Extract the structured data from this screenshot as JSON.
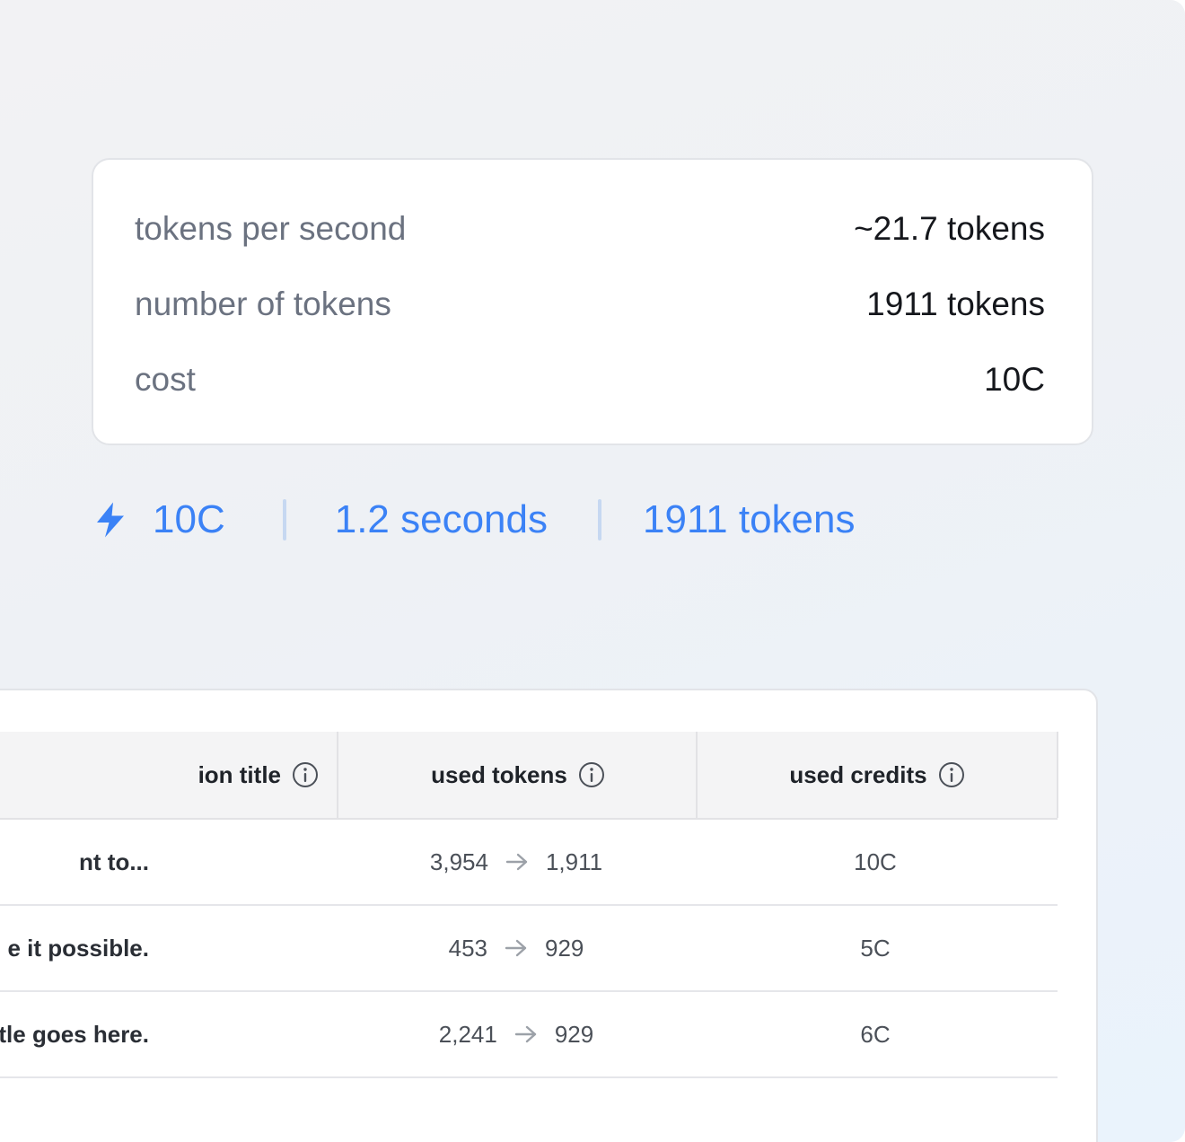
{
  "stats": {
    "rows": [
      {
        "label": "tokens per second",
        "value": "~21.7 tokens"
      },
      {
        "label": "number of tokens",
        "value": "1911 tokens"
      },
      {
        "label": "cost",
        "value": "10C"
      }
    ]
  },
  "summary": {
    "icon": "lightning-icon",
    "credits": "10C",
    "duration": "1.2 seconds",
    "tokens": "1911 tokens",
    "accent_color": "#3b82f6"
  },
  "table": {
    "columns": [
      {
        "label": "ion title",
        "icon": "info-icon"
      },
      {
        "label": "used tokens",
        "icon": "info-icon"
      },
      {
        "label": "used credits",
        "icon": "info-icon"
      }
    ],
    "rows": [
      {
        "title": "nt to...",
        "tokens_in": "3,954",
        "tokens_out": "1,911",
        "credits": "10C"
      },
      {
        "title": "e it possible.",
        "tokens_in": "453",
        "tokens_out": "929",
        "credits": "5C"
      },
      {
        "title": "n title goes here.",
        "tokens_in": "2,241",
        "tokens_out": "929",
        "credits": "6C"
      }
    ]
  }
}
